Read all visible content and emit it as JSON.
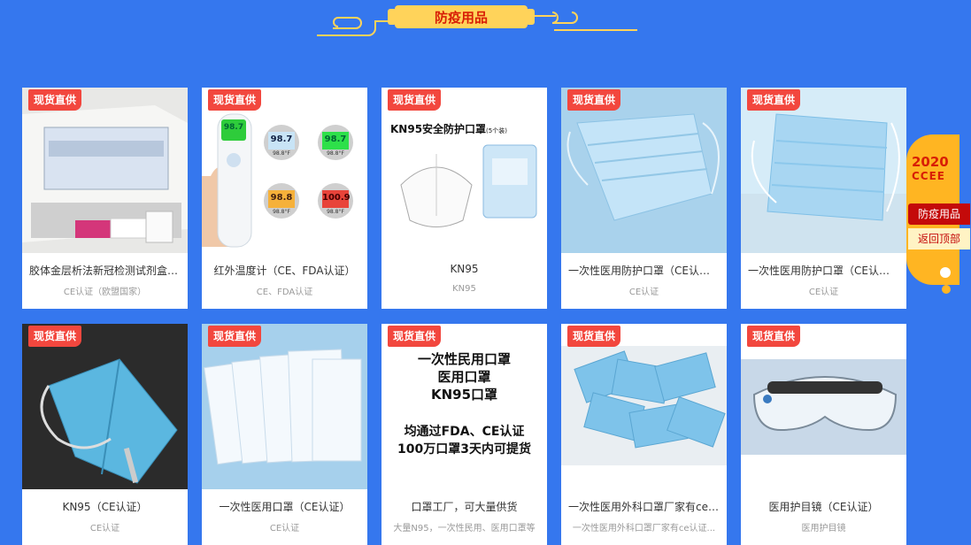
{
  "header": {
    "title": "防疫用品"
  },
  "colors": {
    "background": "#3577ee",
    "badge": "#f2473e",
    "accent": "#d81e06"
  },
  "products": [
    {
      "badge": "现货直供",
      "name": "胶体金层析法新冠检测试剂盒（CE认证）",
      "sub": "CE认证（欧盟国家）",
      "image": "test-kit"
    },
    {
      "badge": "现货直供",
      "name": "红外温度计（CE、FDA认证）",
      "sub": "CE、FDA认证",
      "image": "thermometer",
      "readings": [
        "98.7",
        "98.7",
        "98.7",
        "98.8",
        "100.9"
      ],
      "reading_sub": "98.8°F"
    },
    {
      "badge": "现货直供",
      "name": "KN95",
      "sub": "KN95",
      "image": "kn95-pack",
      "img_title": "KN95安全防护口罩",
      "img_title_note": "(5个装)"
    },
    {
      "badge": "现货直供",
      "name": "一次性医用防护口罩（CE认证）",
      "sub": "CE认证",
      "image": "blue-mask"
    },
    {
      "badge": "现货直供",
      "name": "一次性医用防护口罩（CE认证）",
      "sub": "CE认证",
      "image": "blue-mask-2"
    },
    {
      "badge": "现货直供",
      "name": "KN95（CE认证）",
      "sub": "CE认证",
      "image": "kn95-blue"
    },
    {
      "badge": "现货直供",
      "name": "一次性医用口罩（CE认证）",
      "sub": "CE认证",
      "image": "white-masks"
    },
    {
      "badge": "现货直供",
      "name": "口罩工厂，可大量供货",
      "sub": "大量N95，一次性民用、医用口罩等",
      "image": "text-ad",
      "ad_lines": [
        "一次性民用口罩",
        "医用口罩",
        "KN95口罩",
        "均通过FDA、CE认证",
        "100万口罩3天内可提货"
      ]
    },
    {
      "badge": "现货直供",
      "name": "一次性医用外科口罩厂家有ce认证",
      "sub": "一次性医用外科口罩厂家有ce认证...",
      "image": "surgical-pile"
    },
    {
      "badge": "现货直供",
      "name": "医用护目镜（CE认证）",
      "sub": "医用护目镜",
      "image": "goggles"
    }
  ],
  "side": {
    "logo_year": "2020",
    "logo_text": "CCEE",
    "btn_epidemic": "防疫用品",
    "btn_top": "返回顶部"
  }
}
